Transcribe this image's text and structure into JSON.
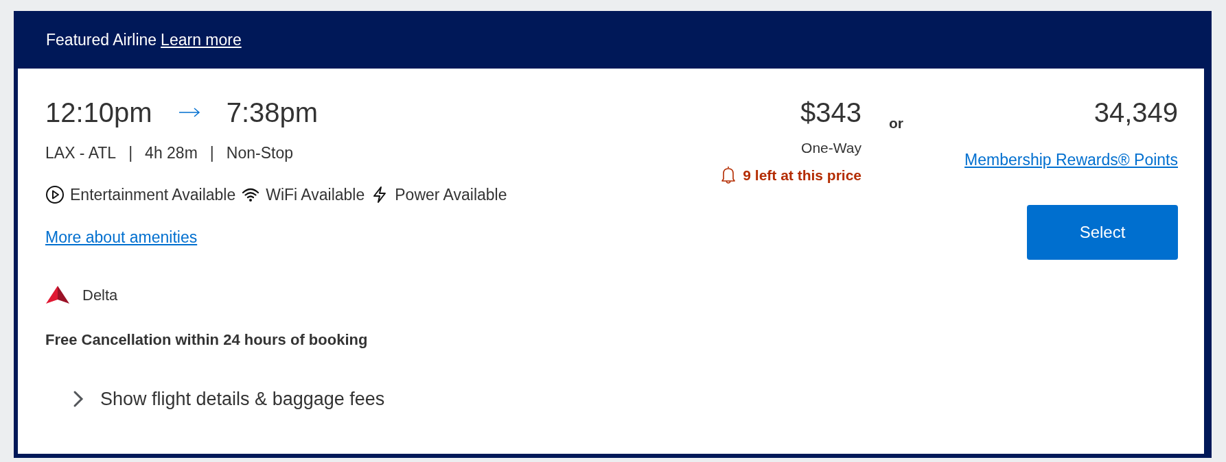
{
  "banner": {
    "label": "Featured Airline",
    "link": "Learn more"
  },
  "flight": {
    "depart": "12:10pm",
    "arrive": "7:38pm",
    "route": "LAX - ATL",
    "duration": "4h 28m",
    "stops": "Non-Stop",
    "dividers": [
      "|",
      "|"
    ],
    "amenities": [
      {
        "kind": "entertainment",
        "label": "Entertainment Available"
      },
      {
        "kind": "wifi",
        "label": "WiFi Available"
      },
      {
        "kind": "power",
        "label": "Power Available"
      }
    ],
    "amenities_link": "More about amenities",
    "airline": "Delta",
    "cancellation": "Free Cancellation within 24 hours of booking",
    "details_toggle": "Show flight details & baggage fees",
    "expanded": false
  },
  "price": {
    "amount": "$343",
    "trip": "One-Way",
    "alert": "9 left at this price"
  },
  "separator": "or",
  "points": {
    "amount": "34,349",
    "link": "Membership Rewards® Points"
  },
  "select_button": "Select"
}
